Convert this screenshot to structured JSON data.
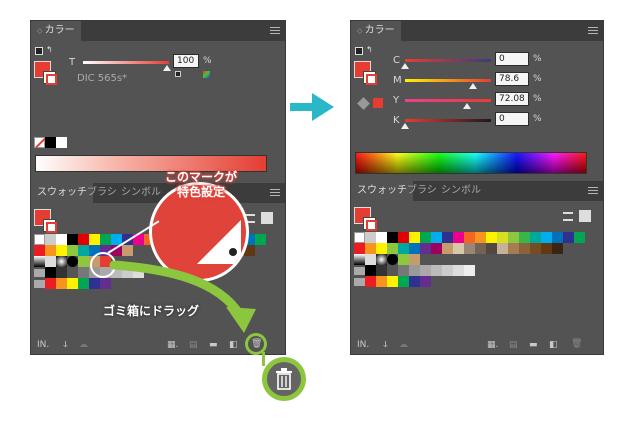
{
  "left_panel": {
    "tab_title": "カラー",
    "tint_label": "T",
    "tint_value": "100",
    "percent": "%",
    "swatch_name": "DIC 565s*",
    "tabs": [
      "スウォッチ",
      "ブラシ",
      "シンボル"
    ],
    "annotation_callout": "このマークが\n特色設定",
    "annotation_arrow": "ゴミ箱にドラッグ",
    "trash_icon": "trash-icon"
  },
  "right_panel": {
    "tab_title": "カラー",
    "channels": [
      {
        "label": "C",
        "value": "0",
        "unit": "%",
        "level": 0
      },
      {
        "label": "M",
        "value": "78.6",
        "unit": "%",
        "level": 0.786
      },
      {
        "label": "Y",
        "value": "72.08",
        "unit": "%",
        "level": 0.7208
      },
      {
        "label": "K",
        "value": "0",
        "unit": "%",
        "level": 0
      }
    ],
    "tabs": [
      "スウォッチ",
      "ブラシ",
      "シンボル"
    ]
  },
  "colors": {
    "accent_red": "#e53d32",
    "callout_red": "#e0433a",
    "arrow_green": "#8cc63f",
    "cyan_arrow": "#2ab8c8"
  }
}
